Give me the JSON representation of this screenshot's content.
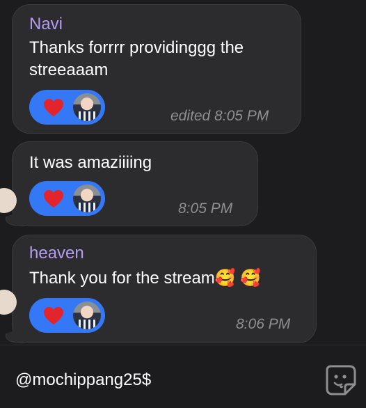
{
  "messages": [
    {
      "sender": "Navi",
      "text_lines": [
        "Thanks forrrr providinggg the",
        "streeaaam"
      ],
      "reaction": {
        "icon": "heart-icon",
        "count_label": ""
      },
      "timestamp": "edited 8:05 PM"
    },
    {
      "sender": "",
      "text_lines": [
        "It was amaziiiing"
      ],
      "reaction": {
        "icon": "heart-icon"
      },
      "timestamp": "8:05 PM"
    },
    {
      "sender": "heaven",
      "text_lines": [
        "Thank you for the stream🥰 🥰"
      ],
      "reaction": {
        "icon": "heart-icon"
      },
      "timestamp": "8:06 PM"
    }
  ],
  "composer": {
    "value": "@mochippang25$",
    "sticker_icon": "sticker-icon"
  },
  "colors": {
    "background": "#1c1c1e",
    "bubble": "#2c2c2e",
    "sender_name": "#b49cf2",
    "reaction_pill": "#3478f6",
    "heart": "#e3242b",
    "timestamp": "#8e8e93"
  }
}
